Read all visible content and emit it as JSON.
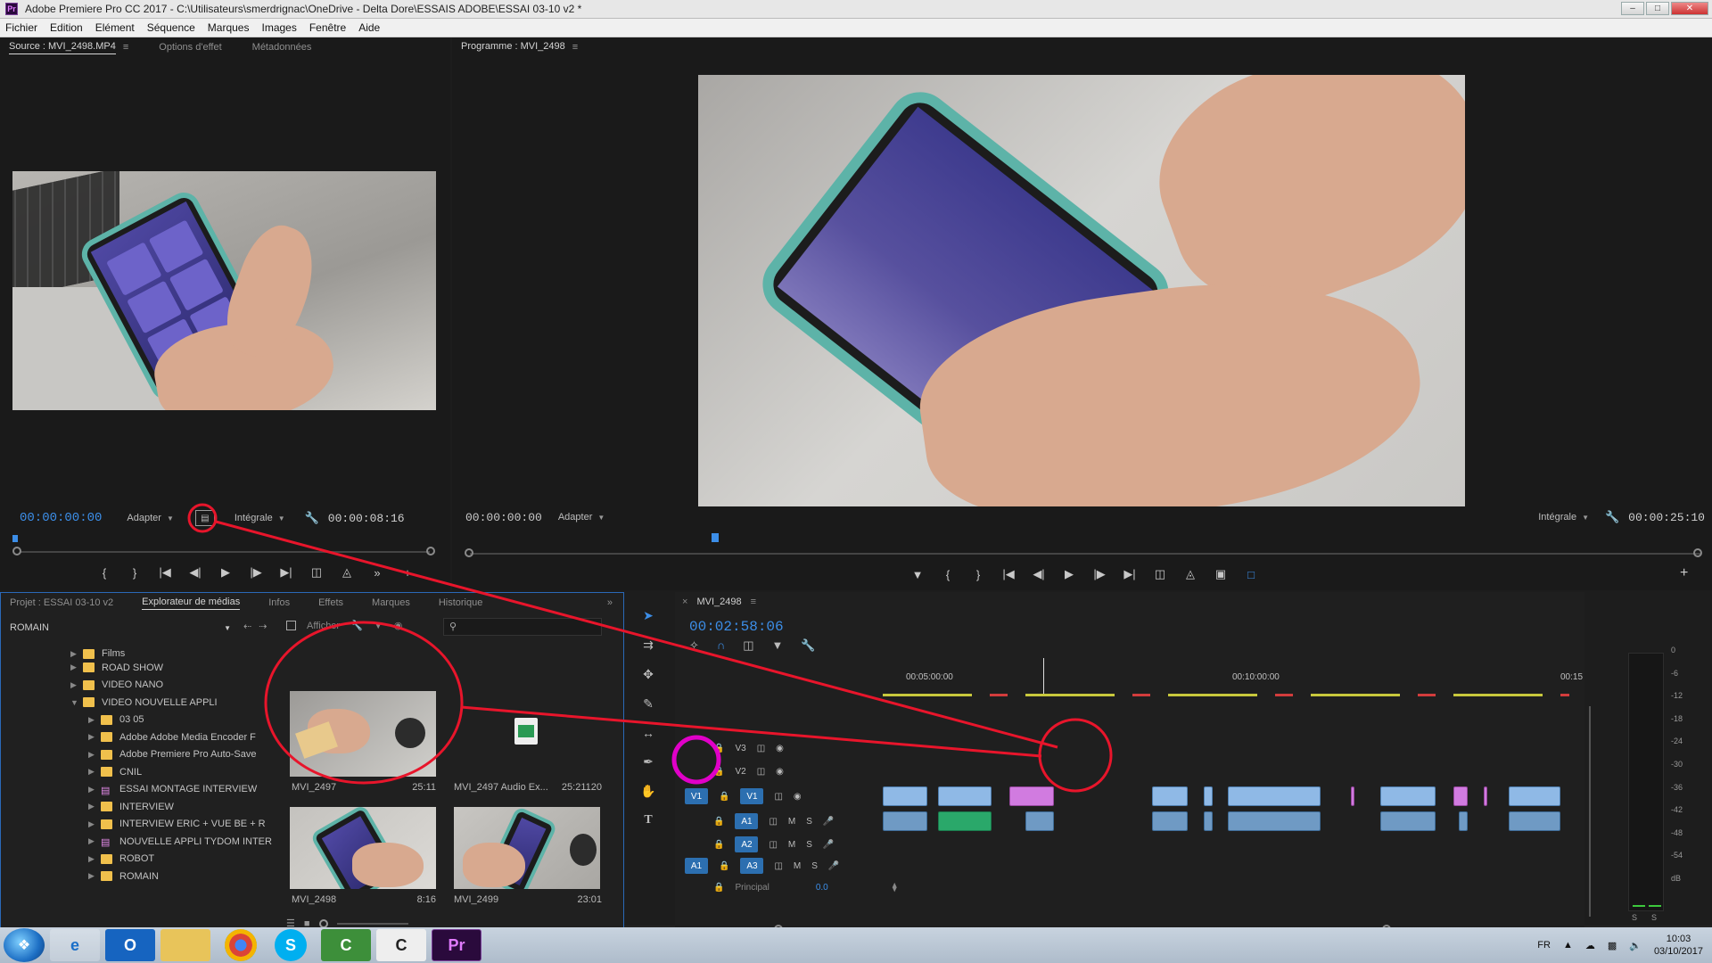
{
  "window": {
    "title": "Adobe Premiere Pro CC 2017 - C:\\Utilisateurs\\smerdrignac\\OneDrive - Delta Dore\\ESSAIS ADOBE\\ESSAI 03-10 v2 *",
    "app_icon": "Pr"
  },
  "menu": [
    "Fichier",
    "Edition",
    "Elément",
    "Séquence",
    "Marques",
    "Images",
    "Fenêtre",
    "Aide"
  ],
  "source": {
    "tabs": [
      "Source : MVI_2498.MP4",
      "Options d'effet",
      "Métadonnées"
    ],
    "timecode_in": "00:00:00:00",
    "fit": "Adapter",
    "resolution": "Intégrale",
    "duration": "00:00:08:16"
  },
  "program": {
    "tab": "Programme : MVI_2498",
    "timecode_in": "00:00:00:00",
    "fit": "Adapter",
    "resolution": "Intégrale",
    "duration": "00:00:25:10"
  },
  "project": {
    "tabs": [
      "Projet : ESSAI 03-10 v2",
      "Explorateur de médias",
      "Infos",
      "Effets",
      "Marques",
      "Historique"
    ],
    "location": "ROMAIN",
    "tree": [
      {
        "label": "Films",
        "type": "folder",
        "expanded": false
      },
      {
        "label": "ROAD SHOW",
        "type": "folder",
        "expanded": false
      },
      {
        "label": "VIDEO NANO",
        "type": "folder",
        "expanded": false
      },
      {
        "label": "VIDEO NOUVELLE APPLI",
        "type": "folder",
        "expanded": true
      },
      {
        "label": "03 05",
        "type": "folder",
        "expanded": false
      },
      {
        "label": "Adobe Adobe Media Encoder F",
        "type": "folder",
        "expanded": false
      },
      {
        "label": "Adobe Premiere Pro Auto-Save",
        "type": "folder",
        "expanded": false
      },
      {
        "label": "CNIL",
        "type": "folder",
        "expanded": false
      },
      {
        "label": "ESSAI MONTAGE INTERVIEW",
        "type": "sequence",
        "expanded": false
      },
      {
        "label": "INTERVIEW",
        "type": "folder",
        "expanded": false
      },
      {
        "label": "INTERVIEW ERIC + VUE BE + R",
        "type": "folder",
        "expanded": false
      },
      {
        "label": "NOUVELLE APPLI TYDOM INTER",
        "type": "sequence",
        "expanded": false
      },
      {
        "label": "ROBOT",
        "type": "folder",
        "expanded": false
      },
      {
        "label": "ROMAIN",
        "type": "folder",
        "expanded": false
      }
    ],
    "media": [
      {
        "name": "MVI_2497",
        "duration": "25:11"
      },
      {
        "name": "MVI_2497 Audio Ex...",
        "duration": "25:21120"
      },
      {
        "name": "MVI_2498",
        "duration": "8:16"
      },
      {
        "name": "MVI_2499",
        "duration": "23:01"
      }
    ],
    "display_toggle": "Afficher"
  },
  "timeline": {
    "tab": "MVI_2498",
    "timecode": "00:02:58:06",
    "ruler": [
      "00:05:00:00",
      "00:10:00:00",
      "00:15"
    ],
    "tracks": [
      {
        "name": "V3",
        "kind": "video"
      },
      {
        "name": "V2",
        "kind": "video"
      },
      {
        "name": "V1",
        "kind": "video",
        "source_patch": "V1"
      },
      {
        "name": "A1",
        "kind": "audio"
      },
      {
        "name": "A2",
        "kind": "audio"
      },
      {
        "name": "A3",
        "kind": "audio",
        "source_patch": "A1"
      }
    ],
    "master_label": "Principal",
    "master_value": "0.0",
    "mute_label": "M",
    "solo_label": "S"
  },
  "meter": {
    "scale": [
      "0",
      "-6",
      "-12",
      "-18",
      "-24",
      "-30",
      "-36",
      "-42",
      "-48",
      "-54",
      "dB"
    ],
    "solo": [
      "S",
      "S"
    ]
  },
  "taskbar": {
    "apps": [
      "Internet Explorer",
      "Outlook",
      "Explorer",
      "Chrome",
      "Skype",
      "Camtasia",
      "Camtasia Recorder",
      "Premiere Pro"
    ],
    "lang": "FR",
    "time": "10:03",
    "date": "03/10/2017"
  },
  "colors": {
    "accent": "#2c6fb0",
    "timecode": "#3c8ee8",
    "annotation_red": "#e8152b",
    "annotation_magenta": "#e000c8"
  }
}
